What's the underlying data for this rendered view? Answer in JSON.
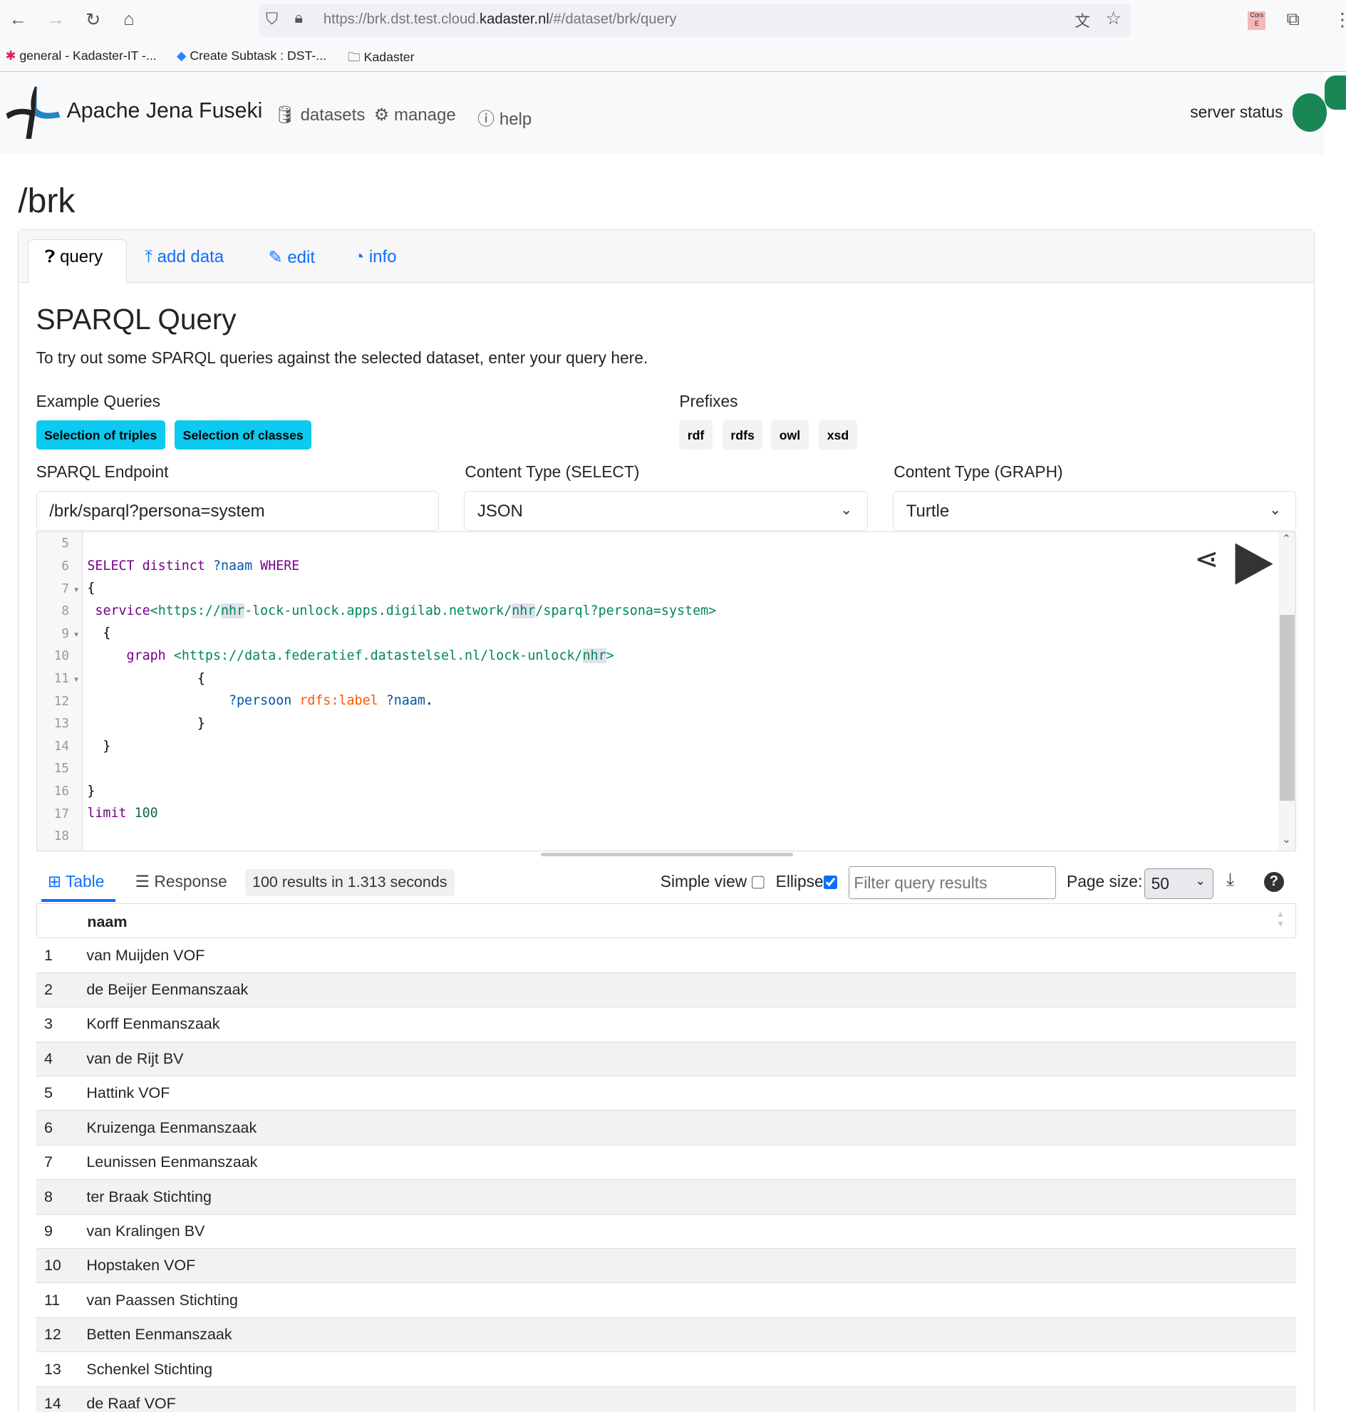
{
  "browser": {
    "url_prefix": "https://brk.dst.test.cloud.",
    "url_domain": "kadaster.nl",
    "url_path": "/#/dataset/brk/query",
    "ext_label": "Cors E",
    "bookmarks": [
      "general - Kadaster-IT -...",
      "Create Subtask : DST-...",
      "Kadaster"
    ]
  },
  "navbar": {
    "brand": "Apache Jena Fuseki",
    "items": [
      "datasets",
      "manage",
      "help"
    ],
    "server_status": "server status",
    "status_color": "#198754"
  },
  "page": {
    "title": "/brk"
  },
  "tabs": [
    "query",
    "add data",
    "edit",
    "info"
  ],
  "query": {
    "heading": "SPARQL Query",
    "intro": "To try out some SPARQL queries against the selected dataset, enter your query here.",
    "examples_label": "Example Queries",
    "examples": [
      "Selection of triples",
      "Selection of classes"
    ],
    "prefixes_label": "Prefixes",
    "prefixes": [
      "rdf",
      "rdfs",
      "owl",
      "xsd"
    ],
    "endpoint_label": "SPARQL Endpoint",
    "endpoint_value": "/brk/sparql?persona=system",
    "select_label": "Content Type (SELECT)",
    "select_value": "JSON",
    "graph_label": "Content Type (GRAPH)",
    "graph_value": "Turtle"
  },
  "editor": {
    "line_numbers": [
      "5",
      "6",
      "7",
      "8",
      "9",
      "10",
      "11",
      "12",
      "13",
      "14",
      "15",
      "16",
      "17",
      "18"
    ]
  },
  "results": {
    "tab_table": "Table",
    "tab_response": "Response",
    "summary": "100 results in 1.313 seconds",
    "simple_view": "Simple view",
    "simple_view_checked": false,
    "ellipse": "Ellipse",
    "ellipse_checked": true,
    "filter_placeholder": "Filter query results",
    "page_size_label": "Page size:",
    "page_size": "50",
    "column": "naam",
    "rows": [
      [
        "1",
        "van Muijden VOF"
      ],
      [
        "2",
        "de Beijer Eenmanszaak"
      ],
      [
        "3",
        "Korff Eenmanszaak"
      ],
      [
        "4",
        "van de Rijt BV"
      ],
      [
        "5",
        "Hattink VOF"
      ],
      [
        "6",
        "Kruizenga Eenmanszaak"
      ],
      [
        "7",
        "Leunissen Eenmanszaak"
      ],
      [
        "8",
        "ter Braak Stichting"
      ],
      [
        "9",
        "van Kralingen BV"
      ],
      [
        "10",
        "Hopstaken VOF"
      ],
      [
        "11",
        "van Paassen Stichting"
      ],
      [
        "12",
        "Betten Eenmanszaak"
      ],
      [
        "13",
        "Schenkel Stichting"
      ],
      [
        "14",
        "de Raaf VOF"
      ]
    ]
  }
}
